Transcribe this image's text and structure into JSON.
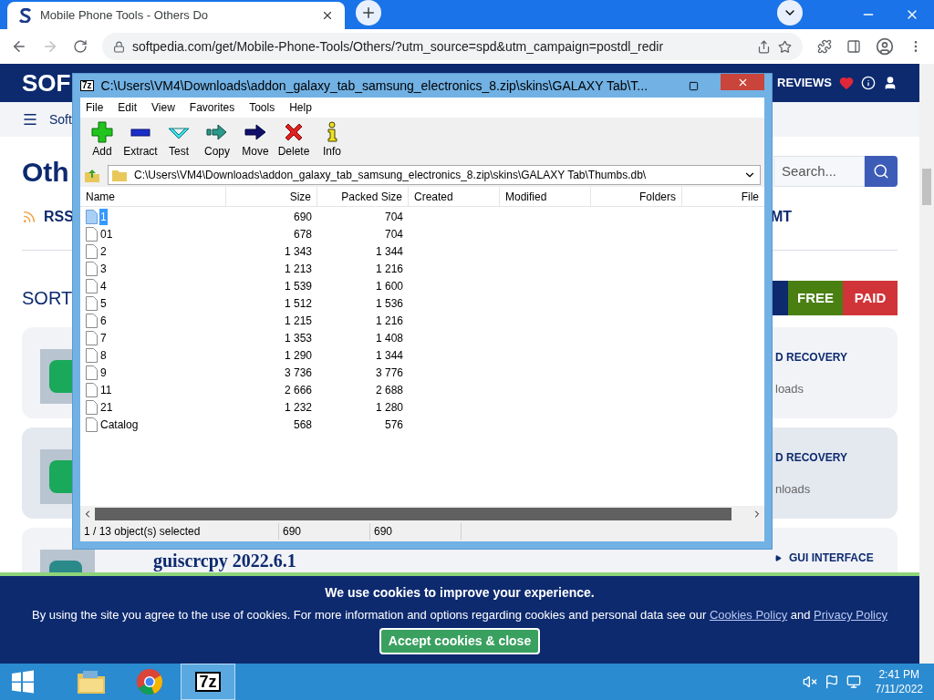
{
  "browser": {
    "tab": {
      "title": "Mobile Phone Tools - Others Do"
    },
    "address": "softpedia.com/get/Mobile-Phone-Tools/Others/?utm_source=spd&utm_campaign=postdl_redir"
  },
  "page": {
    "logo": "SOF",
    "nav_right": "REVIEWS",
    "breadcrumb": "Soft",
    "heading": "Oth",
    "search": {
      "placeholder": "Search..."
    },
    "rss": "RSS",
    "tag_tail": "MT",
    "sort": "SORT",
    "filters": [
      {
        "label": "FREE",
        "color": "#4a7f12"
      },
      {
        "label": "PAID",
        "color": "#d13438"
      }
    ],
    "cards": [
      {
        "category": "D RECOVERY",
        "meta": "loads"
      },
      {
        "category": "D RECOVERY",
        "meta": "nloads"
      },
      {
        "title": "guiscrcpy 2022.6.1",
        "category": "GUI INTERFACE"
      }
    ],
    "cookie": {
      "title": "We use cookies to improve your experience.",
      "text": "By using the site you agree to the use of cookies. For more information and options regarding cookies and personal data see our",
      "link_1": "Cookies Policy",
      "joiner": "and",
      "link_2": "Privacy Policy",
      "button": "Accept cookies & close"
    }
  },
  "sevenzip": {
    "icon_text": "7z",
    "title": "C:\\Users\\VM4\\Downloads\\addon_galaxy_tab_samsung_electronics_8.zip\\skins\\GALAXY Tab\\T...",
    "menu": [
      "File",
      "Edit",
      "View",
      "Favorites",
      "Tools",
      "Help"
    ],
    "toolbar": [
      {
        "kind": "add",
        "label": "Add"
      },
      {
        "kind": "extract",
        "label": "Extract"
      },
      {
        "kind": "test",
        "label": "Test"
      },
      {
        "kind": "copy",
        "label": "Copy"
      },
      {
        "kind": "move",
        "label": "Move"
      },
      {
        "kind": "delete",
        "label": "Delete"
      },
      {
        "kind": "info",
        "label": "Info"
      }
    ],
    "path": "C:\\Users\\VM4\\Downloads\\addon_galaxy_tab_samsung_electronics_8.zip\\skins\\GALAXY Tab\\Thumbs.db\\",
    "columns": [
      "Name",
      "Size",
      "Packed Size",
      "Created",
      "Modified",
      "Folders",
      "File"
    ],
    "rows": [
      {
        "name": "1",
        "size": "690",
        "packed": "704",
        "selected": true
      },
      {
        "name": "01",
        "size": "678",
        "packed": "704",
        "selected": false
      },
      {
        "name": "2",
        "size": "1 343",
        "packed": "1 344",
        "selected": false
      },
      {
        "name": "3",
        "size": "1 213",
        "packed": "1 216",
        "selected": false
      },
      {
        "name": "4",
        "size": "1 539",
        "packed": "1 600",
        "selected": false
      },
      {
        "name": "5",
        "size": "1 512",
        "packed": "1 536",
        "selected": false
      },
      {
        "name": "6",
        "size": "1 215",
        "packed": "1 216",
        "selected": false
      },
      {
        "name": "7",
        "size": "1 353",
        "packed": "1 408",
        "selected": false
      },
      {
        "name": "8",
        "size": "1 290",
        "packed": "1 344",
        "selected": false
      },
      {
        "name": "9",
        "size": "3 736",
        "packed": "3 776",
        "selected": false
      },
      {
        "name": "11",
        "size": "2 666",
        "packed": "2 688",
        "selected": false
      },
      {
        "name": "21",
        "size": "1 232",
        "packed": "1 280",
        "selected": false
      },
      {
        "name": "Catalog",
        "size": "568",
        "packed": "576",
        "selected": false
      }
    ],
    "status": [
      "1 / 13 object(s) selected",
      "690",
      "690"
    ]
  },
  "taskbar": {
    "apps": [
      {
        "kind": "explorer",
        "active": false
      },
      {
        "kind": "chrome",
        "active": false
      },
      {
        "kind": "sevenzip",
        "active": true,
        "label": "7z"
      }
    ],
    "time": "2:41 PM",
    "date": "7/11/2022"
  }
}
